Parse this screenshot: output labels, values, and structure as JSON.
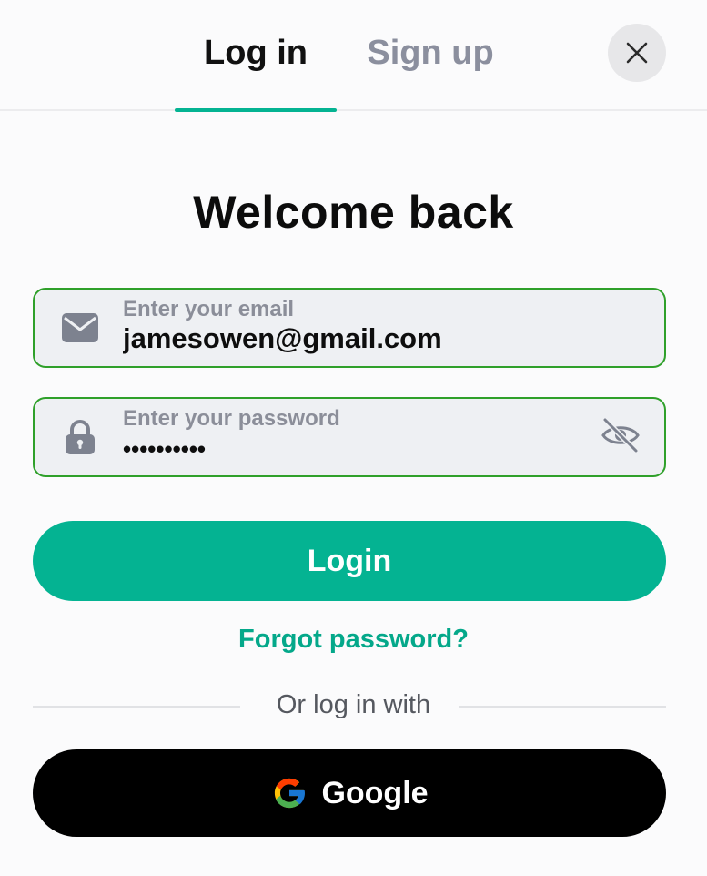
{
  "tabs": {
    "login_label": "Log in",
    "signup_label": "Sign up",
    "active": "login"
  },
  "close_icon": "close-icon",
  "heading": "Welcome back",
  "email_field": {
    "label": "Enter your email",
    "value": "jamesowen@gmail.com",
    "icon": "mail-icon"
  },
  "password_field": {
    "label": "Enter your password",
    "value": "••••••••••",
    "icon": "lock-icon",
    "toggle_icon": "eye-off-icon"
  },
  "login_button": "Login",
  "forgot_link": "Forgot password?",
  "divider_text": "Or log in with",
  "google_button": {
    "label": "Google",
    "icon": "google-icon"
  },
  "colors": {
    "accent": "#04b392",
    "field_border": "#2fa02a",
    "field_bg": "#eef0f3",
    "google_bg": "#000000"
  }
}
